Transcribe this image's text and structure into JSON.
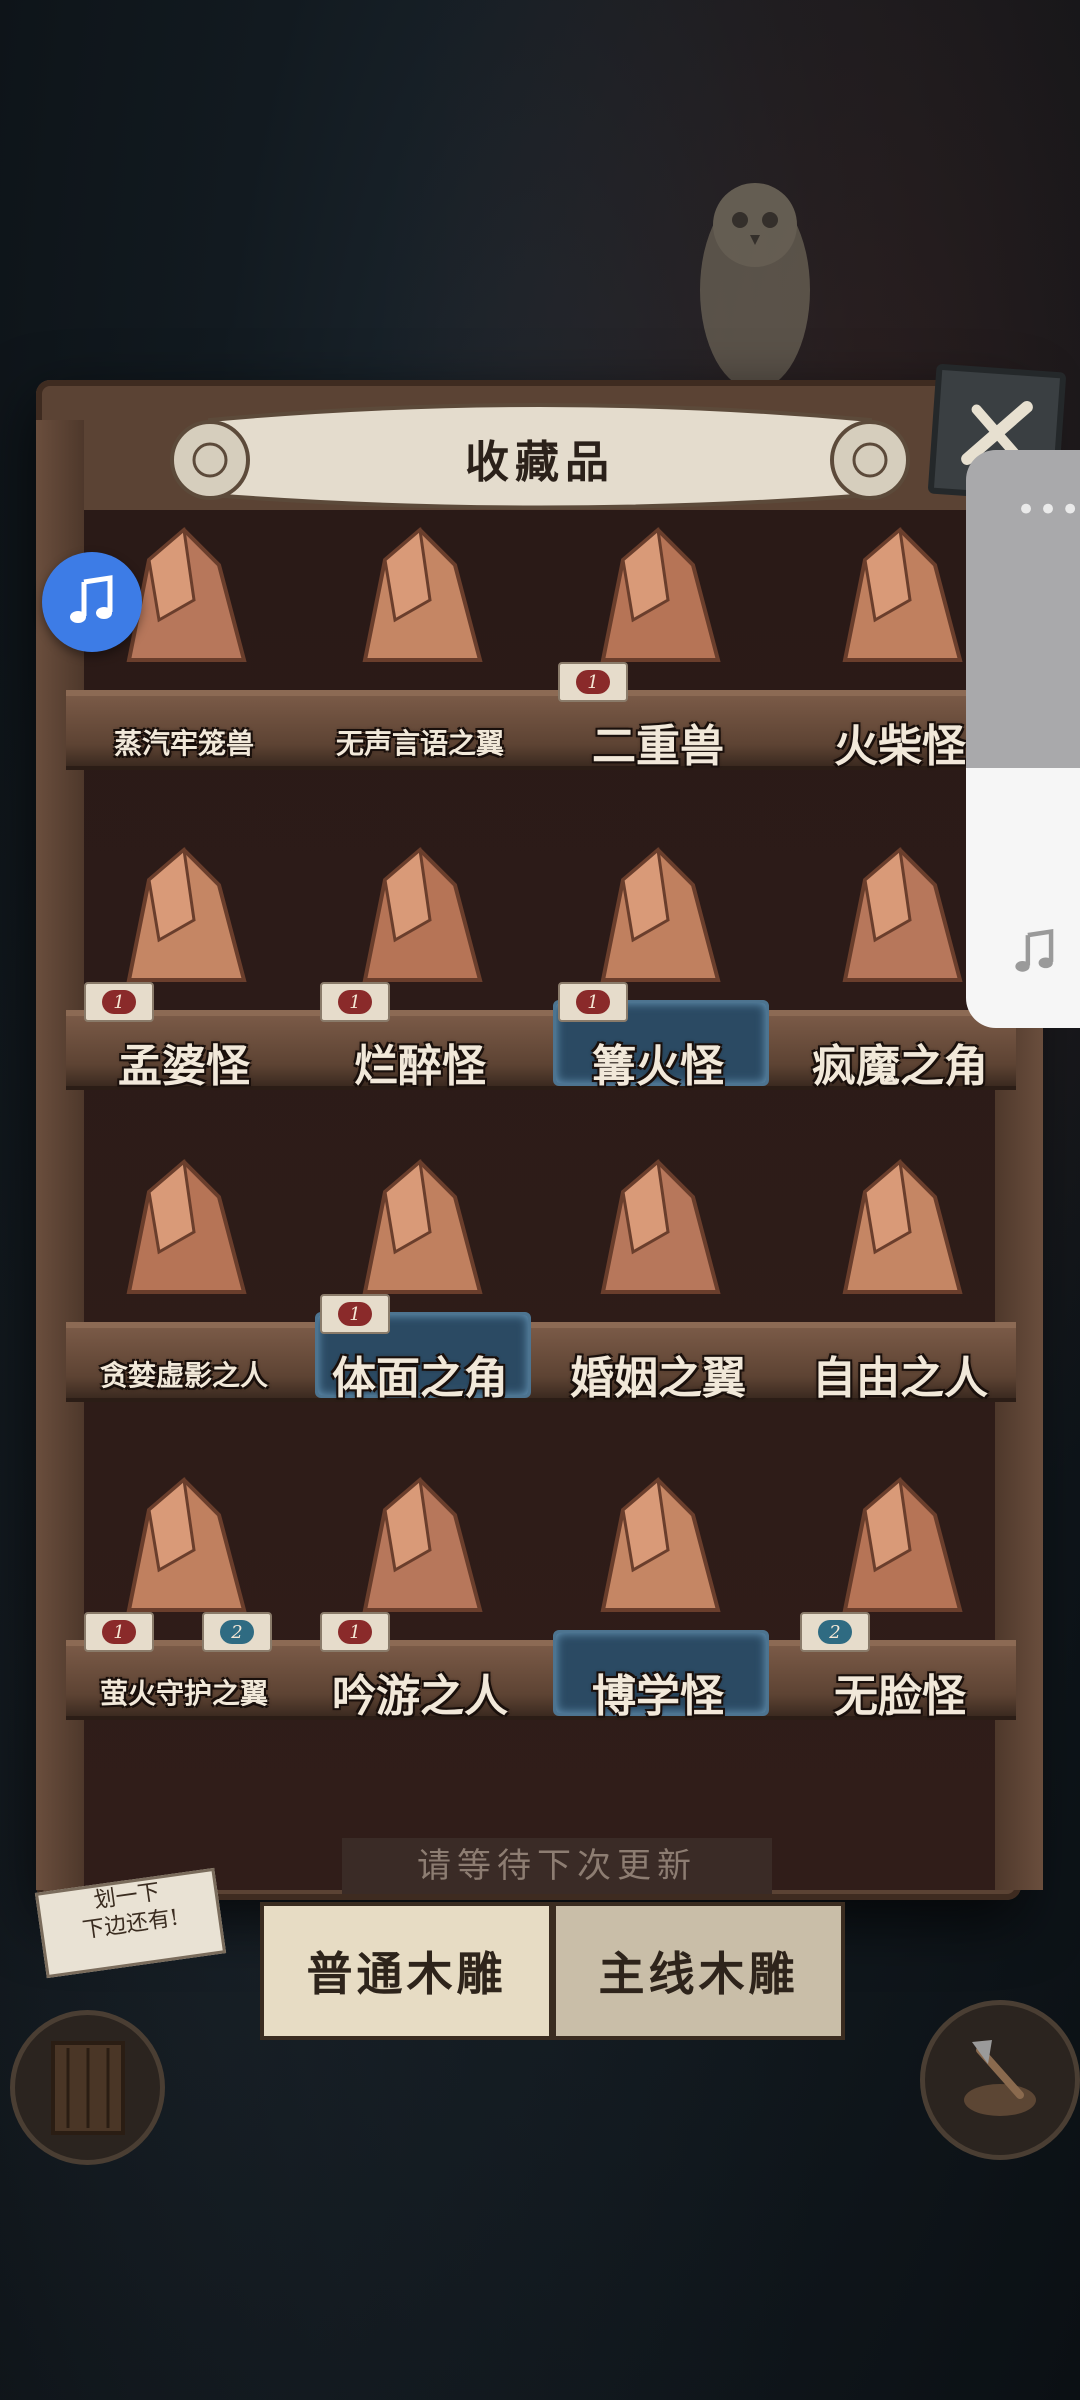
{
  "title": "收藏品",
  "shelves": [
    {
      "items": [
        {
          "name": "蒸汽牢笼兽",
          "size": "small"
        },
        {
          "name": "无声言语之翼",
          "size": "small"
        },
        {
          "name": "二重兽",
          "size": "big",
          "tags": [
            {
              "num": "1",
              "color": "red"
            }
          ]
        },
        {
          "name": "火柴怪",
          "size": "big"
        }
      ]
    },
    {
      "items": [
        {
          "name": "孟婆怪",
          "size": "big",
          "tags": [
            {
              "num": "1",
              "color": "red"
            }
          ]
        },
        {
          "name": "烂醉怪",
          "size": "big",
          "tags": [
            {
              "num": "1",
              "color": "red"
            }
          ]
        },
        {
          "name": "篝火怪",
          "size": "big",
          "highlight": true,
          "tags": [
            {
              "num": "1",
              "color": "red"
            }
          ]
        },
        {
          "name": "疯魔之角",
          "size": "big"
        }
      ]
    },
    {
      "items": [
        {
          "name": "贪婪虚影之人",
          "size": "small"
        },
        {
          "name": "体面之角",
          "size": "big",
          "highlight": true,
          "tags": [
            {
              "num": "1",
              "color": "red"
            }
          ]
        },
        {
          "name": "婚姻之翼",
          "size": "big"
        },
        {
          "name": "自由之人",
          "size": "big"
        }
      ]
    },
    {
      "items": [
        {
          "name": "萤火守护之翼",
          "size": "small",
          "tags": [
            {
              "num": "1",
              "color": "red"
            },
            {
              "num": "2",
              "color": "blue"
            }
          ]
        },
        {
          "name": "吟游之人",
          "size": "big",
          "tags": [
            {
              "num": "1",
              "color": "red"
            }
          ]
        },
        {
          "name": "博学怪",
          "size": "big",
          "highlight": true
        },
        {
          "name": "无脸怪",
          "size": "big",
          "tags": [
            {
              "num": "2",
              "color": "blue"
            }
          ]
        }
      ]
    }
  ],
  "update_notice": "请等待下次更新",
  "scroll_hint": [
    "划一下",
    "下边还有!"
  ],
  "tabs": {
    "common": "普通木雕",
    "main": "主线木雕"
  },
  "colors": {
    "wood": "#5b4334",
    "label": "#f1e8d9",
    "music_fab": "#3d7ce6"
  },
  "icons": {
    "close": "close-x-icon",
    "music": "music-note-icon",
    "door": "door-icon",
    "axe": "axe-icon"
  }
}
